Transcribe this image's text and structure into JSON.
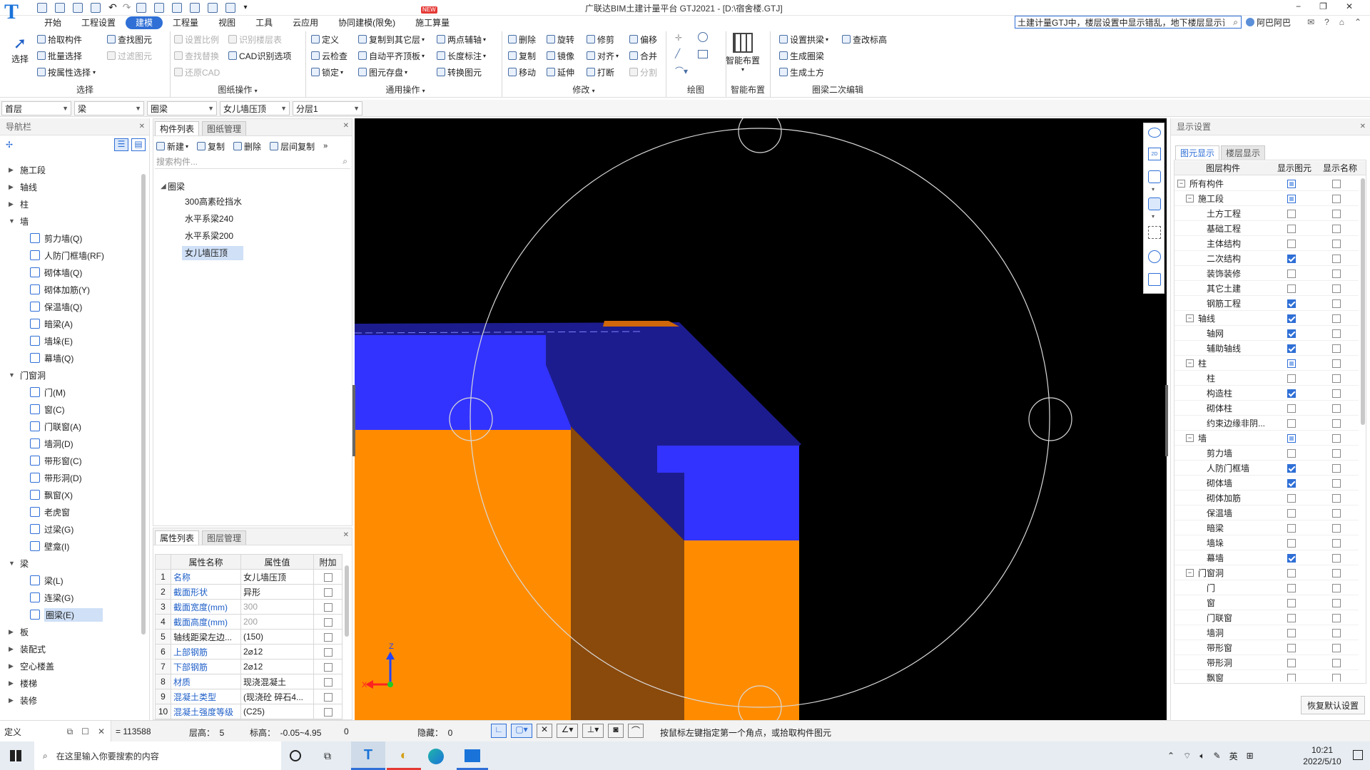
{
  "titlebar": {
    "title": "广联达BIM土建计量平台 GTJ2021 - [D:\\宿舍楼.GTJ]",
    "search_value": "土建计量GTJ中，楼层设置中显示错乱，地下楼层显示试",
    "user": "阿巴阿巴",
    "new_badge": "NEW"
  },
  "menu": [
    "开始",
    "工程设置",
    "建模",
    "工程量",
    "视图",
    "工具",
    "云应用",
    "协同建模(限免)",
    "施工算量"
  ],
  "menu_active_index": 2,
  "ribbon": {
    "select": "选择",
    "g1": {
      "label": "选择",
      "items": [
        "拾取构件",
        "批量选择",
        "按属性选择",
        "查找图元",
        "过滤图元"
      ]
    },
    "g2": {
      "label": "图纸操作",
      "items": [
        "设置比例",
        "识别楼层表",
        "查找替换",
        "CAD识别选项",
        "还原CAD"
      ]
    },
    "g3": {
      "label": "通用操作",
      "items": [
        "定义",
        "复制到其它层",
        "两点辅轴",
        "云检查",
        "自动平齐顶板",
        "长度标注",
        "锁定",
        "图元存盘",
        "转换图元"
      ]
    },
    "g4": {
      "label": "修改",
      "items": [
        "删除",
        "旋转",
        "修剪",
        "偏移",
        "复制",
        "镜像",
        "对齐",
        "合并",
        "移动",
        "延伸",
        "打断",
        "分割"
      ]
    },
    "g5": {
      "label": "绘图"
    },
    "g6": {
      "label": "智能布置",
      "big": "智能布置"
    },
    "g7": {
      "label": "圈梁二次编辑",
      "items": [
        "设置拱梁",
        "查改标高",
        "生成圈梁",
        "生成土方"
      ]
    }
  },
  "filters": [
    "首层",
    "梁",
    "圈梁",
    "女儿墙压顶",
    "分层1"
  ],
  "nav": {
    "title": "导航栏",
    "items": [
      {
        "label": "施工段",
        "level": 0,
        "state": "collapsed"
      },
      {
        "label": "轴线",
        "level": 0,
        "state": "collapsed"
      },
      {
        "label": "柱",
        "level": 0,
        "state": "collapsed"
      },
      {
        "label": "墙",
        "level": 0,
        "state": "expanded"
      },
      {
        "label": "剪力墙(Q)",
        "level": 1
      },
      {
        "label": "人防门框墙(RF)",
        "level": 1
      },
      {
        "label": "砌体墙(Q)",
        "level": 1
      },
      {
        "label": "砌体加筋(Y)",
        "level": 1
      },
      {
        "label": "保温墙(Q)",
        "level": 1
      },
      {
        "label": "暗梁(A)",
        "level": 1
      },
      {
        "label": "墙垛(E)",
        "level": 1
      },
      {
        "label": "幕墙(Q)",
        "level": 1
      },
      {
        "label": "门窗洞",
        "level": 0,
        "state": "expanded"
      },
      {
        "label": "门(M)",
        "level": 1
      },
      {
        "label": "窗(C)",
        "level": 1
      },
      {
        "label": "门联窗(A)",
        "level": 1
      },
      {
        "label": "墙洞(D)",
        "level": 1
      },
      {
        "label": "带形窗(C)",
        "level": 1
      },
      {
        "label": "带形洞(D)",
        "level": 1
      },
      {
        "label": "飘窗(X)",
        "level": 1
      },
      {
        "label": "老虎窗",
        "level": 1
      },
      {
        "label": "过梁(G)",
        "level": 1
      },
      {
        "label": "壁龛(I)",
        "level": 1
      },
      {
        "label": "梁",
        "level": 0,
        "state": "expanded"
      },
      {
        "label": "梁(L)",
        "level": 1
      },
      {
        "label": "连梁(G)",
        "level": 1
      },
      {
        "label": "圈梁(E)",
        "level": 1,
        "selected": true
      },
      {
        "label": "板",
        "level": 0,
        "state": "collapsed"
      },
      {
        "label": "装配式",
        "level": 0,
        "state": "collapsed"
      },
      {
        "label": "空心楼盖",
        "level": 0,
        "state": "collapsed"
      },
      {
        "label": "楼梯",
        "level": 0,
        "state": "collapsed"
      },
      {
        "label": "装修",
        "level": 0,
        "state": "collapsed"
      }
    ]
  },
  "component_panel": {
    "tabs": [
      "构件列表",
      "图纸管理"
    ],
    "toolbar": [
      "新建",
      "复制",
      "删除",
      "层间复制"
    ],
    "search_placeholder": "搜索构件...",
    "root": "圈梁",
    "items": [
      "300高素砼挡水",
      "水平系梁240",
      "水平系梁200",
      "女儿墙压顶"
    ],
    "selected_index": 3
  },
  "property_panel": {
    "tabs": [
      "属性列表",
      "图层管理"
    ],
    "headers": [
      "属性名称",
      "属性值",
      "附加"
    ],
    "rows": [
      {
        "n": "1",
        "name": "名称",
        "value": "女儿墙压顶",
        "blue": true,
        "grey": false
      },
      {
        "n": "2",
        "name": "截面形状",
        "value": "异形",
        "blue": true,
        "grey": false
      },
      {
        "n": "3",
        "name": "截面宽度(mm)",
        "value": "300",
        "blue": true,
        "grey": true
      },
      {
        "n": "4",
        "name": "截面高度(mm)",
        "value": "200",
        "blue": true,
        "grey": true
      },
      {
        "n": "5",
        "name": "轴线距梁左边...",
        "value": "(150)",
        "blue": false,
        "grey": false
      },
      {
        "n": "6",
        "name": "上部钢筋",
        "value": "2⌀12",
        "blue": true,
        "grey": false
      },
      {
        "n": "7",
        "name": "下部钢筋",
        "value": "2⌀12",
        "blue": true,
        "grey": false
      },
      {
        "n": "8",
        "name": "材质",
        "value": "现浇混凝土",
        "blue": true,
        "grey": false
      },
      {
        "n": "9",
        "name": "混凝土类型",
        "value": "(现浇砼 碎石4...",
        "blue": true,
        "grey": false
      },
      {
        "n": "10",
        "name": "混凝土强度等级",
        "value": "(C25)",
        "blue": true,
        "grey": false
      }
    ]
  },
  "display_panel": {
    "title": "显示设置",
    "tabs": [
      "图元显示",
      "楼层显示"
    ],
    "headers": [
      "图层构件",
      "显示图元",
      "显示名称"
    ],
    "rows": [
      {
        "label": "所有构件",
        "level": 0,
        "toggle": "−",
        "show": "part",
        "name": "off"
      },
      {
        "label": "施工段",
        "level": 1,
        "toggle": "−",
        "show": "part",
        "name": "off"
      },
      {
        "label": "土方工程",
        "level": 2,
        "show": "off",
        "name": "off"
      },
      {
        "label": "基础工程",
        "level": 2,
        "show": "off",
        "name": "off"
      },
      {
        "label": "主体结构",
        "level": 2,
        "show": "off",
        "name": "off"
      },
      {
        "label": "二次结构",
        "level": 2,
        "show": "on",
        "name": "off"
      },
      {
        "label": "装饰装修",
        "level": 2,
        "show": "off",
        "name": "off"
      },
      {
        "label": "其它土建",
        "level": 2,
        "show": "off",
        "name": "off"
      },
      {
        "label": "钢筋工程",
        "level": 2,
        "show": "on",
        "name": "off"
      },
      {
        "label": "轴线",
        "level": 1,
        "toggle": "−",
        "show": "on",
        "name": "off"
      },
      {
        "label": "轴网",
        "level": 2,
        "show": "on",
        "name": "off"
      },
      {
        "label": "辅助轴线",
        "level": 2,
        "show": "on",
        "name": "off"
      },
      {
        "label": "柱",
        "level": 1,
        "toggle": "−",
        "show": "part",
        "name": "off"
      },
      {
        "label": "柱",
        "level": 2,
        "show": "off",
        "name": "off"
      },
      {
        "label": "构造柱",
        "level": 2,
        "show": "on",
        "name": "off"
      },
      {
        "label": "砌体柱",
        "level": 2,
        "show": "off",
        "name": "off"
      },
      {
        "label": "约束边缘非阴...",
        "level": 2,
        "show": "off",
        "name": "off"
      },
      {
        "label": "墙",
        "level": 1,
        "toggle": "−",
        "show": "part",
        "name": "off"
      },
      {
        "label": "剪力墙",
        "level": 2,
        "show": "off",
        "name": "off"
      },
      {
        "label": "人防门框墙",
        "level": 2,
        "show": "on",
        "name": "off"
      },
      {
        "label": "砌体墙",
        "level": 2,
        "show": "on",
        "name": "off"
      },
      {
        "label": "砌体加筋",
        "level": 2,
        "show": "off",
        "name": "off"
      },
      {
        "label": "保温墙",
        "level": 2,
        "show": "off",
        "name": "off"
      },
      {
        "label": "暗梁",
        "level": 2,
        "show": "off",
        "name": "off"
      },
      {
        "label": "墙垛",
        "level": 2,
        "show": "off",
        "name": "off"
      },
      {
        "label": "幕墙",
        "level": 2,
        "show": "on",
        "name": "off"
      },
      {
        "label": "门窗洞",
        "level": 1,
        "toggle": "−",
        "show": "off",
        "name": "off"
      },
      {
        "label": "门",
        "level": 2,
        "show": "off",
        "name": "off"
      },
      {
        "label": "窗",
        "level": 2,
        "show": "off",
        "name": "off"
      },
      {
        "label": "门联窗",
        "level": 2,
        "show": "off",
        "name": "off"
      },
      {
        "label": "墙洞",
        "level": 2,
        "show": "off",
        "name": "off"
      },
      {
        "label": "带形窗",
        "level": 2,
        "show": "off",
        "name": "off"
      },
      {
        "label": "带形洞",
        "level": 2,
        "show": "off",
        "name": "off"
      },
      {
        "label": "飘窗",
        "level": 2,
        "show": "off",
        "name": "off"
      }
    ],
    "restore": "恢复默认设置"
  },
  "statusbar": {
    "define": "定义",
    "coord": "= 113588",
    "floor_height": "层高：  5",
    "elevation": "标高：  -0.05~4.95",
    "zero": "0",
    "hidden": "隐藏：  0",
    "hint": "按鼠标左键指定第一个角点，或拾取构件图元"
  },
  "taskbar": {
    "search_placeholder": "在这里输入你要搜索的内容",
    "ime": "英",
    "time": "10:21",
    "date": "2022/5/10"
  },
  "colors": {
    "canvas": "#000000",
    "blue_beam": "#3333ff",
    "orange_wall": "#ff8c00",
    "accent": "#2f6fd6"
  }
}
